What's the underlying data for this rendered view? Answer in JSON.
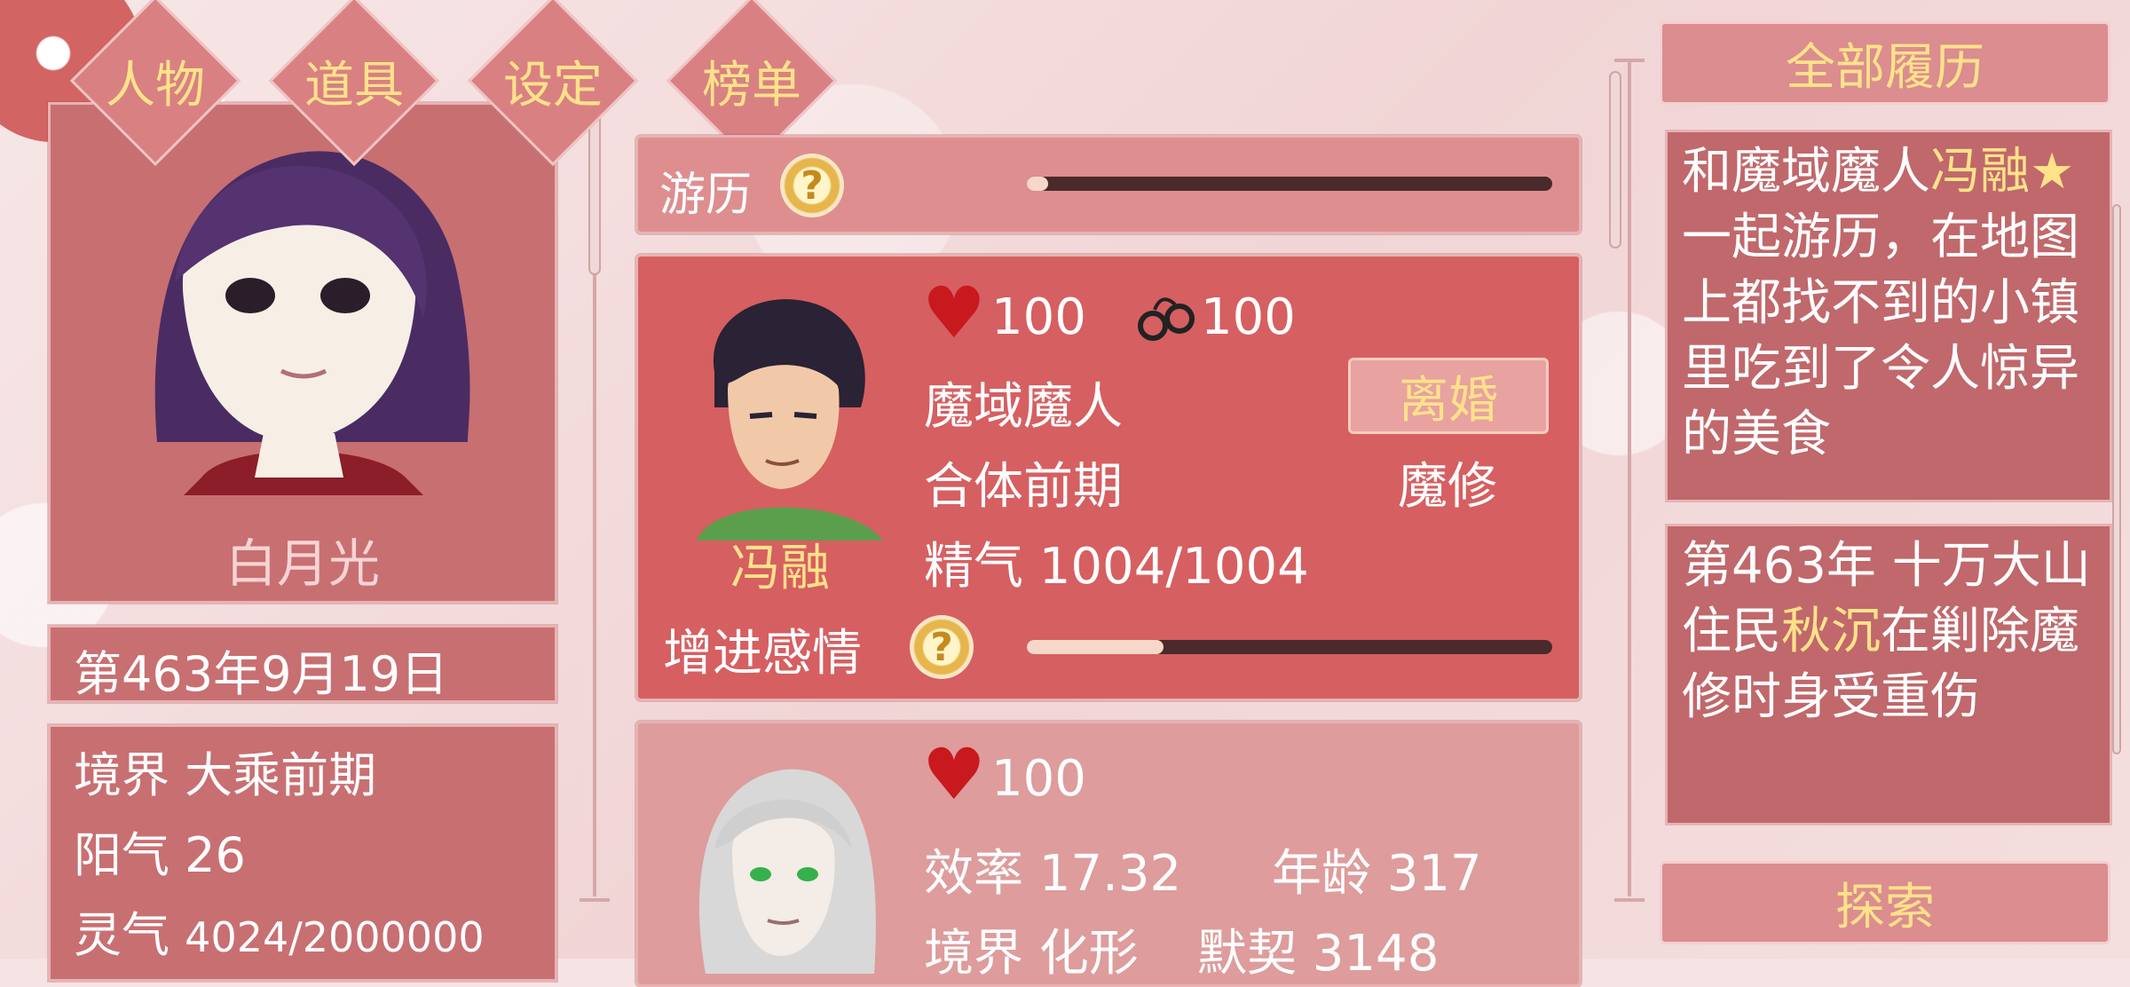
{
  "tabs": [
    {
      "label": "人物"
    },
    {
      "label": "道具"
    },
    {
      "label": "设定"
    },
    {
      "label": "榜单"
    }
  ],
  "player": {
    "name": "白月光",
    "date": "第463年9月19日",
    "realm": "境界 大乘前期",
    "yang": "阳气 26",
    "qi_label": "灵气",
    "qi_value": "4024/2000000"
  },
  "travel": {
    "label": "游历",
    "help": "?",
    "progress": 0.04
  },
  "companion1": {
    "name": "冯融",
    "love": "100",
    "bond": "100",
    "race": "魔域魔人",
    "stage": "合体前期",
    "jingqi": "精气 1004/1004",
    "divorce_label": "离婚",
    "cultivation": "魔修",
    "affection_label": "增进感情",
    "help": "?",
    "affection_progress": 0.26
  },
  "companion2": {
    "love": "100",
    "efficiency": "效率 17.32",
    "age": "年龄 317",
    "realm": "境界 化形",
    "tacit": "默契 3148"
  },
  "history": {
    "title": "全部履历",
    "entry1": {
      "pre": "和魔域魔人",
      "name": "冯融",
      "star": "★",
      "post": "一起游历，在地图上都找不到的小镇里吃到了令人惊异的美食"
    },
    "entry2": {
      "pre": "第463年 十万大山住民",
      "name": "秋沉",
      "post": "在剿除魔修时身受重伤"
    }
  },
  "explore_label": "探索",
  "colors": {
    "panel": "#c86f72",
    "highlight_text": "#ffe28a",
    "heart": "#c8191e"
  }
}
